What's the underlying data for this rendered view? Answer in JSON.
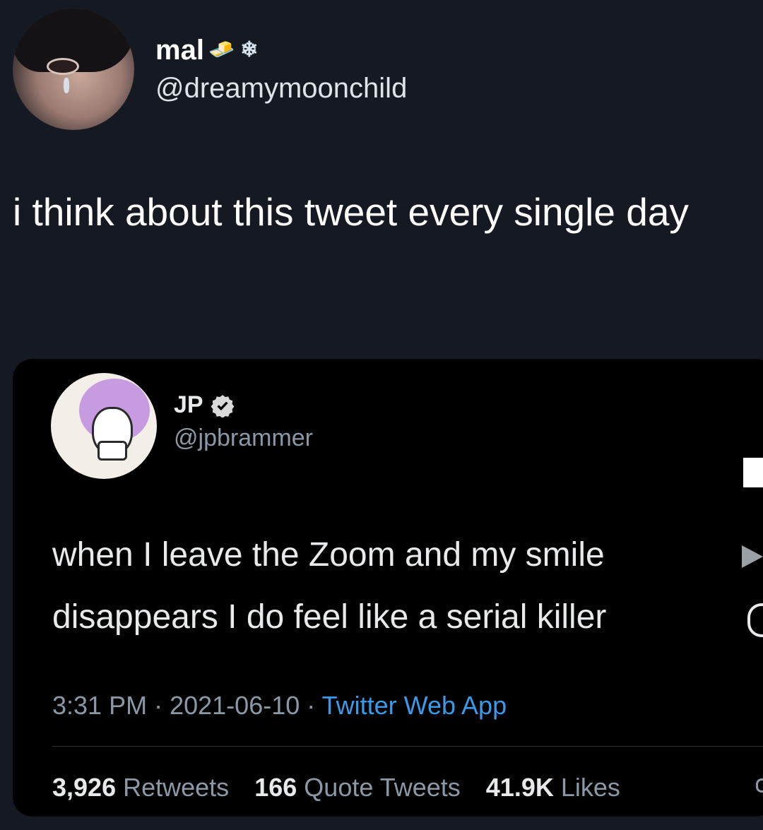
{
  "outer_tweet": {
    "display_name": "mal",
    "name_emoji_1": "🧈",
    "name_emoji_2": "❄",
    "handle": "@dreamymoonchild",
    "text": "i think about this tweet every single day"
  },
  "quoted_tweet": {
    "display_name": "JP",
    "handle": "@jpbrammer",
    "text": "when I leave the Zoom and my smile disappears I do feel like a serial killer",
    "time": "3:31 PM",
    "date": "2021-06-10",
    "separator": "·",
    "source_app": "Twitter Web App",
    "stats": {
      "retweets_count": "3,926",
      "retweets_label": "Retweets",
      "quote_tweets_count": "166",
      "quote_tweets_label": "Quote Tweets",
      "likes_count": "41.9K",
      "likes_label": "Likes"
    }
  },
  "colors": {
    "background": "#151a22",
    "card_background": "#000000",
    "link_blue": "#3b9ae8",
    "muted_gray": "#8b98a5"
  },
  "icons": [
    "verified-badge-icon"
  ]
}
